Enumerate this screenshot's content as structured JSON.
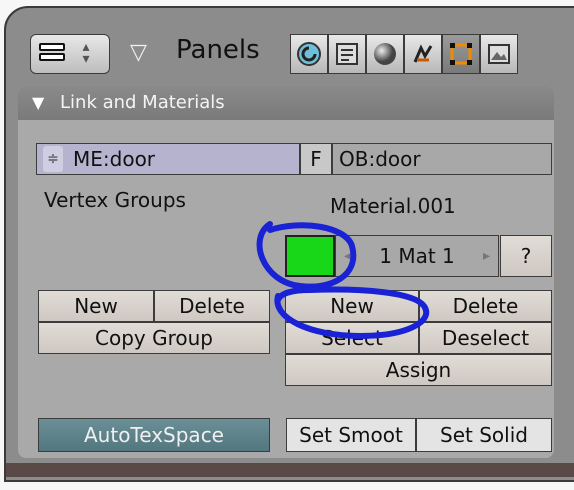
{
  "header": {
    "panels_label": "Panels",
    "tabs": [
      {
        "icon": "logic-icon"
      },
      {
        "icon": "script-icon"
      },
      {
        "icon": "shading-icon"
      },
      {
        "icon": "object-icon"
      },
      {
        "icon": "editing-icon",
        "active": true
      },
      {
        "icon": "scene-icon"
      }
    ]
  },
  "panel": {
    "title": "Link and Materials",
    "mesh_field": "ME:door",
    "f_label": "F",
    "object_field": "OB:door",
    "vertex_groups_label": "Vertex Groups",
    "material_name": "Material.001",
    "material_color": "#18d618",
    "mat_counter": "1 Mat 1",
    "question_label": "?",
    "vg_buttons": {
      "new": "New",
      "delete": "Delete",
      "copy_group": "Copy Group"
    },
    "mat_buttons": {
      "new": "New",
      "delete": "Delete",
      "select": "Select",
      "deselect": "Deselect",
      "assign": "Assign"
    },
    "bottom_buttons": {
      "autotexspace": "AutoTexSpace",
      "set_smooth": "Set Smoot",
      "set_solid": "Set Solid"
    }
  },
  "annotation_color": "#1a22d6"
}
